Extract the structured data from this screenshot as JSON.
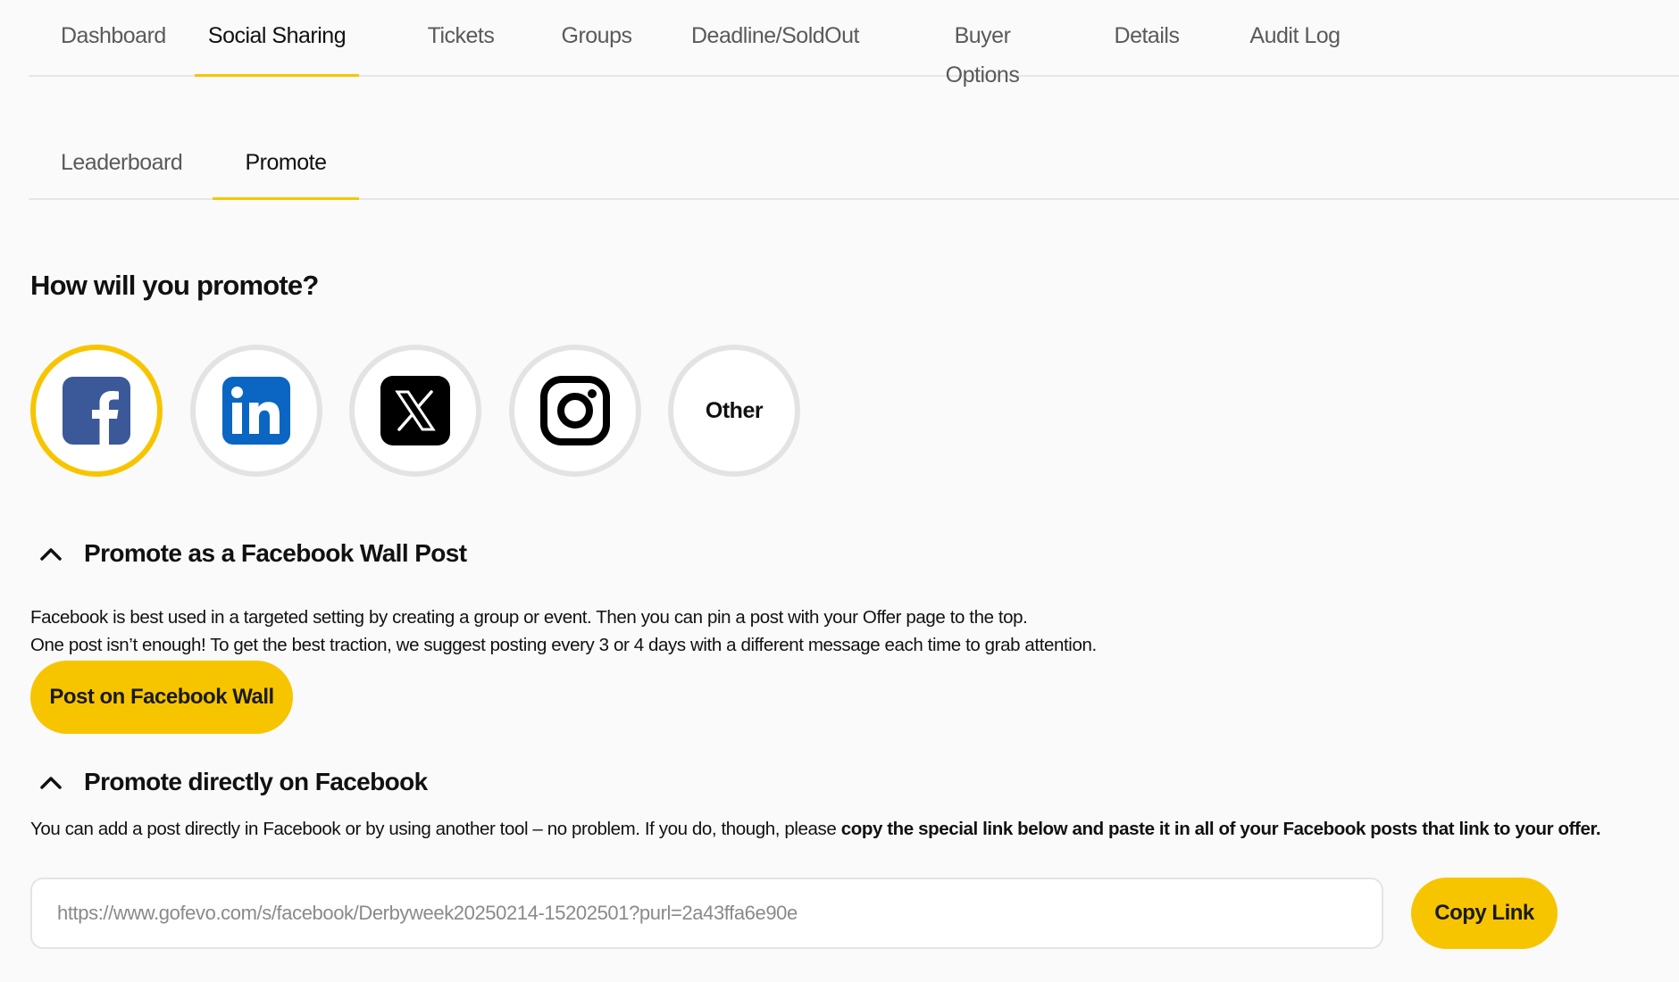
{
  "top_tabs": [
    "Dashboard",
    "Social Sharing",
    "Tickets",
    "Groups",
    "Deadline/SoldOut",
    "Buyer Options",
    "Details",
    "Audit Log"
  ],
  "sub_tabs": [
    "Leaderboard",
    "Promote"
  ],
  "promote": {
    "question": "How will you promote?",
    "channels": [
      "facebook-icon",
      "linkedin-icon",
      "x-icon",
      "instagram-icon"
    ],
    "other_label": "Other",
    "selected_channel": "facebook"
  },
  "wall_post": {
    "title": "Promote as a Facebook Wall Post",
    "line1": "Facebook is best used in a targeted setting by creating a group or event. Then you can pin a post with your Offer page to the top.",
    "line2": "One post isn’t enough! To get the best traction, we suggest posting every 3 or 4 days with a different message each time to grab attention.",
    "button": "Post on Facebook Wall"
  },
  "direct": {
    "title": "Promote directly on Facebook",
    "text_plain": "You can add a post directly in Facebook or by using another tool – no problem. If you do, though, please ",
    "text_bold": "copy the special link below and paste it in all of your Facebook posts that link to your offer.",
    "link": "https://www.gofevo.com/s/facebook/Derbyweek20250214-15202501?purl=2a43ffa6e90e",
    "copy_button": "Copy Link"
  },
  "colors": {
    "accent": "#f7c500",
    "facebook": "#3b5998",
    "linkedin": "#0a66c2"
  }
}
